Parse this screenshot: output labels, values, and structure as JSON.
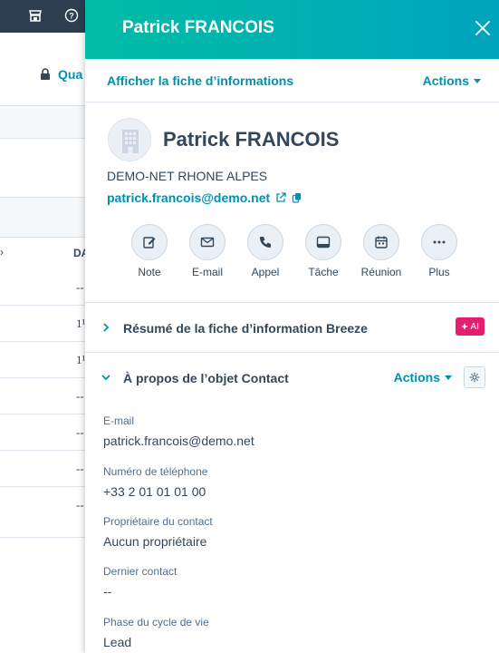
{
  "background": {
    "topbar_icons": [
      "marketplace-icon",
      "help-icon"
    ],
    "quality_label": "Qua",
    "column_header": "DA",
    "rows": [
      "--",
      "1¹",
      "1¹",
      "--",
      "--",
      "--",
      "--"
    ]
  },
  "panel": {
    "title": "Patrick FRANCOIS",
    "view_record_link": "Afficher la fiche d’informations",
    "actions_label": "Actions"
  },
  "contact": {
    "name": "Patrick FRANCOIS",
    "company": "DEMO-NET RHONE ALPES",
    "email": "patrick.francois@demo.net"
  },
  "quick_actions": [
    {
      "label": "Note",
      "icon": "pencil-icon"
    },
    {
      "label": "E-mail",
      "icon": "envelope-icon"
    },
    {
      "label": "Appel",
      "icon": "phone-icon"
    },
    {
      "label": "Tâche",
      "icon": "task-icon"
    },
    {
      "label": "Réunion",
      "icon": "calendar-icon"
    },
    {
      "label": "Plus",
      "icon": "more-icon"
    }
  ],
  "sections": {
    "breeze": {
      "title": "Résumé de la fiche d’information Breeze",
      "badge": "AI"
    },
    "about": {
      "title": "À propos de l’objet Contact",
      "actions_label": "Actions"
    }
  },
  "properties": [
    {
      "label": "E-mail",
      "value": "patrick.francois@demo.net"
    },
    {
      "label": "Numéro de téléphone",
      "value": "+33 2 01 01 01 00"
    },
    {
      "label": "Propriétaire du contact",
      "value": "Aucun propriétaire"
    },
    {
      "label": "Dernier contact",
      "value": "--"
    },
    {
      "label": "Phase du cycle de vie",
      "value": "Lead"
    }
  ],
  "colors": {
    "header_gradient_start": "#00bda5",
    "header_gradient_end": "#00a4bd",
    "link": "#0091ae",
    "ai_badge": "#e41d6f",
    "topbar": "#2d3e50"
  }
}
